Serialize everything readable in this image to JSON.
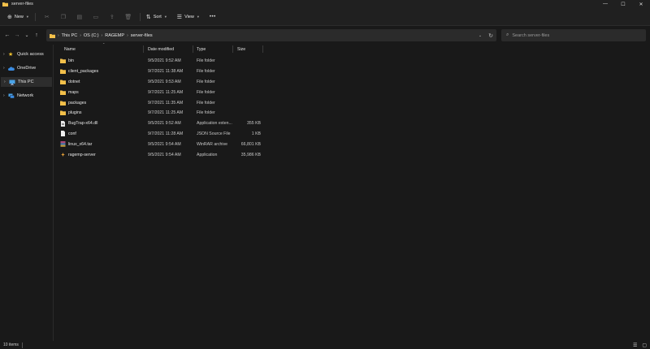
{
  "window": {
    "title": "server-files"
  },
  "window_controls": {
    "minimize": "—",
    "maximize": "☐",
    "close": "✕"
  },
  "toolbar": {
    "new_label": "New",
    "sort_label": "Sort",
    "view_label": "View",
    "more_label": "•••"
  },
  "nav": {
    "back": "←",
    "forward": "→",
    "recent": "⌄",
    "up": "↑"
  },
  "address": {
    "crumbs": [
      "This PC",
      "OS (C:)",
      "RAGEMP",
      "server-files"
    ],
    "dropdown": "⌄",
    "refresh": "↻"
  },
  "search": {
    "placeholder": "Search server-files",
    "icon": "search-icon"
  },
  "sidebar": {
    "items": [
      {
        "label": "Quick access",
        "icon": "star-icon",
        "color": "#f2c12e"
      },
      {
        "label": "OneDrive",
        "icon": "cloud-icon",
        "color": "#3b8be0"
      },
      {
        "label": "This PC",
        "icon": "computer-icon",
        "color": "#4aa3e8"
      },
      {
        "label": "Network",
        "icon": "network-icon",
        "color": "#4aa3e8"
      }
    ]
  },
  "columns": {
    "name": "Name",
    "date": "Date modified",
    "type": "Type",
    "size": "Size"
  },
  "files": [
    {
      "name": "bin",
      "date": "9/5/2021 9:52 AM",
      "type": "File folder",
      "size": "",
      "icon": "folder-icon"
    },
    {
      "name": "client_packages",
      "date": "9/7/2021 11:38 AM",
      "type": "File folder",
      "size": "",
      "icon": "folder-icon"
    },
    {
      "name": "dotnet",
      "date": "9/5/2021 9:53 AM",
      "type": "File folder",
      "size": "",
      "icon": "folder-icon"
    },
    {
      "name": "maps",
      "date": "9/7/2021 11:25 AM",
      "type": "File folder",
      "size": "",
      "icon": "folder-icon"
    },
    {
      "name": "packages",
      "date": "9/7/2021 11:35 AM",
      "type": "File folder",
      "size": "",
      "icon": "folder-icon"
    },
    {
      "name": "plugins",
      "date": "9/7/2021 11:25 AM",
      "type": "File folder",
      "size": "",
      "icon": "folder-icon"
    },
    {
      "name": "BugTrap-x64.dll",
      "date": "9/5/2021 9:52 AM",
      "type": "Application exten...",
      "size": "355 KB",
      "icon": "dll-file-icon"
    },
    {
      "name": "conf",
      "date": "9/7/2021 11:28 AM",
      "type": "JSON Source File",
      "size": "1 KB",
      "icon": "json-file-icon"
    },
    {
      "name": "linux_x64.tar",
      "date": "9/5/2021 9:54 AM",
      "type": "WinRAR archive",
      "size": "66,801 KB",
      "icon": "archive-icon"
    },
    {
      "name": "ragemp-server",
      "date": "9/5/2021 9:54 AM",
      "type": "Application",
      "size": "35,986 KB",
      "icon": "app-icon"
    }
  ],
  "status": {
    "items_count": "10 items"
  },
  "colors": {
    "folder": "#f3c04a",
    "background": "#191919",
    "accent": "#4aa3e8"
  }
}
